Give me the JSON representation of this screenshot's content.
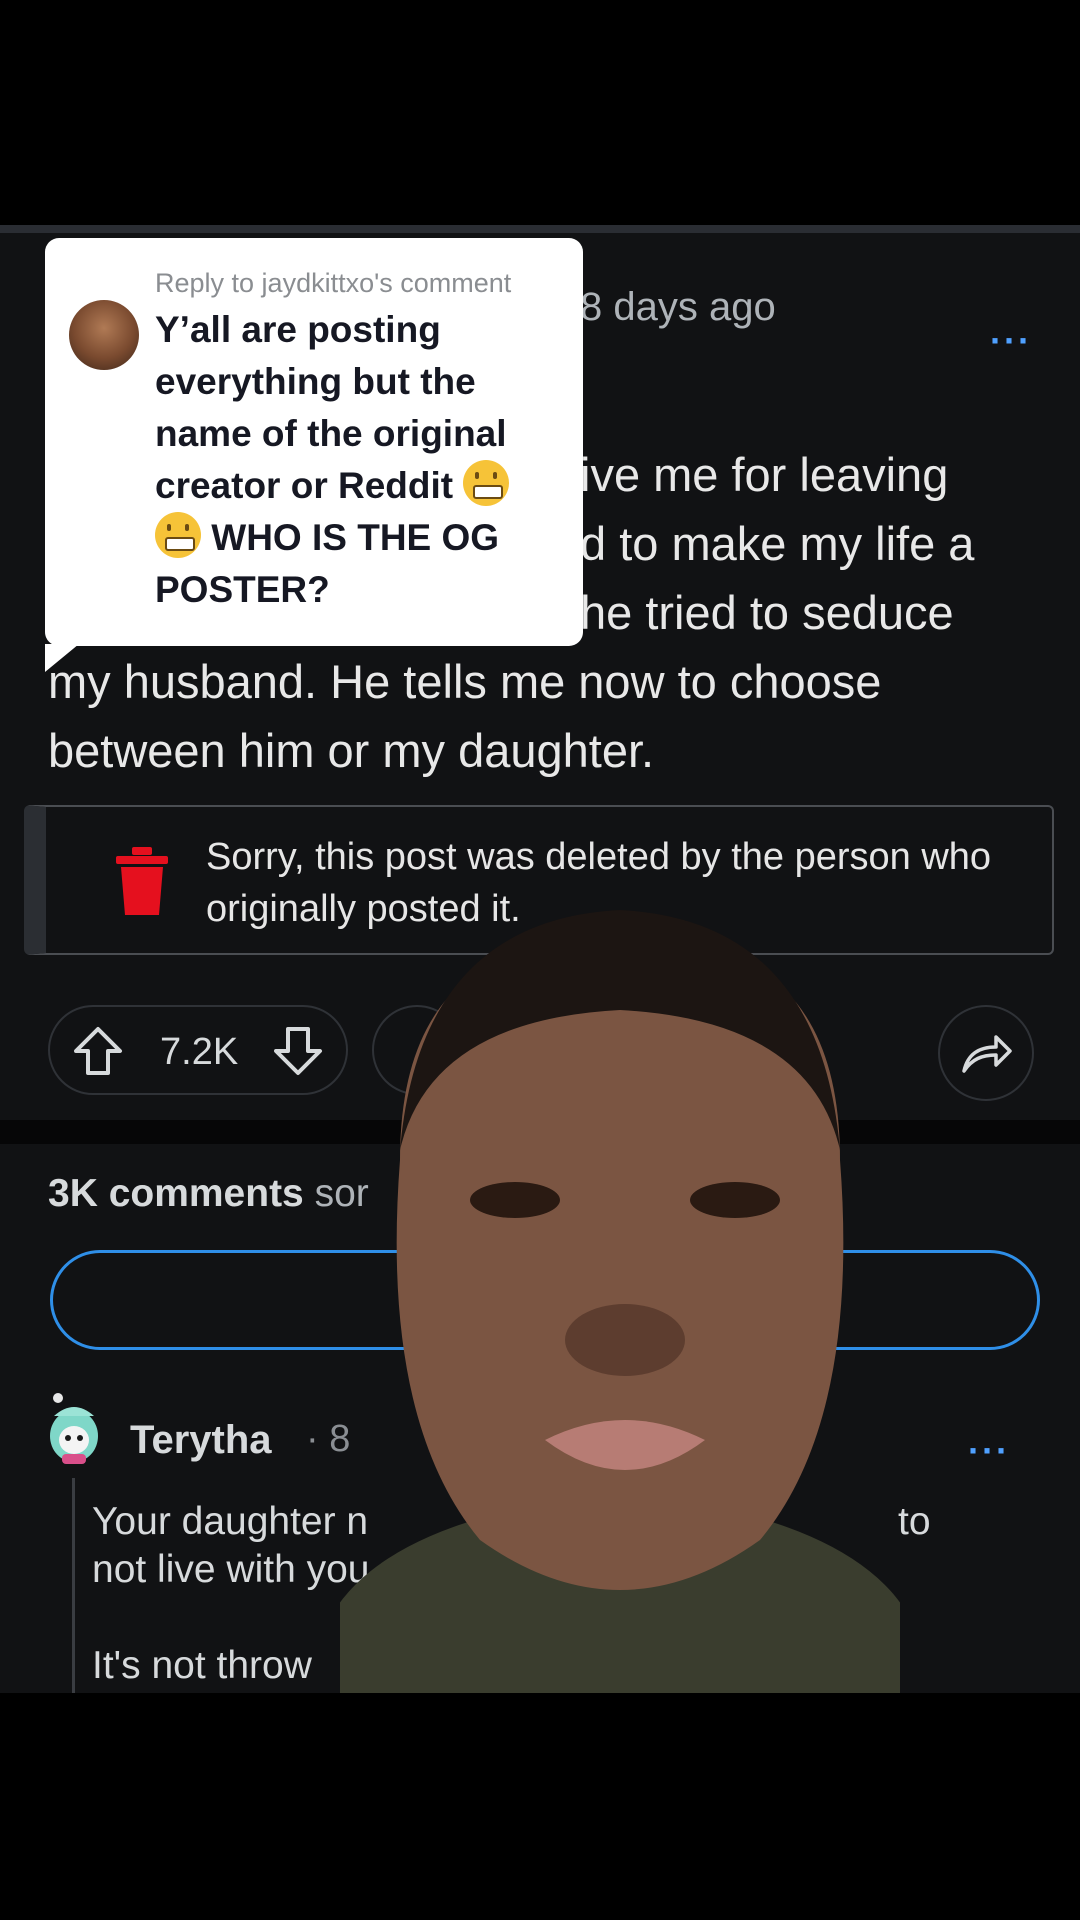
{
  "post": {
    "time_ago": "8 days ago",
    "more_label": "···",
    "body_lines": [
      "ive me for leaving",
      "d to make my life a",
      "he tried to seduce",
      "my husband. He tells me now to choose",
      "between him or my daughter."
    ],
    "deleted_notice": "Sorry, this post was deleted by the person who originally posted it.",
    "vote_count": "7.2K"
  },
  "comments": {
    "count_label": "3K comments",
    "sort_fragment": "sor"
  },
  "comment": {
    "author": "Terytha",
    "time_fragment": "· 8",
    "more_label": "···",
    "lines": [
      {
        "left": "Your daughter n",
        "right": "to"
      },
      {
        "left": "not live with you a",
        "right": ""
      },
      {
        "left": "It's not throw",
        "right": ""
      }
    ]
  },
  "reply_card": {
    "label": "Reply to jaydkittxo's comment",
    "text_lines": [
      "Y’all are posting",
      "everything but the",
      "name of the original",
      "creator or Reddit",
      "WHO IS THE OG",
      "POSTER?"
    ]
  },
  "colors": {
    "accent_blue": "#2f8fe8",
    "trash_red": "#e5101e",
    "background": "#111214"
  }
}
